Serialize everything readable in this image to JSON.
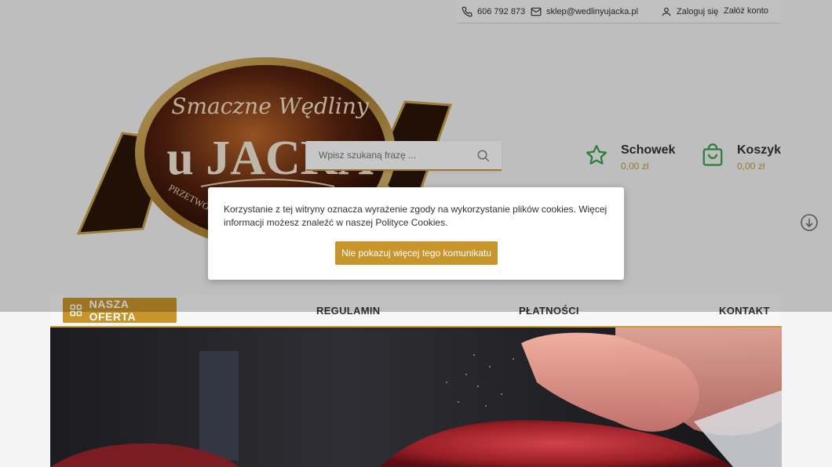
{
  "topbar": {
    "phone": "606 792 873",
    "email": "sklep@wedlinyujacka.pl",
    "login": "Zaloguj się",
    "register": "Załóż konto"
  },
  "logo": {
    "line1": "Smaczne Wędliny",
    "line2": "u JACKA",
    "ribbon": "PRZETWÓRSTWO MIĘSA"
  },
  "search": {
    "placeholder": "Wpisz szukaną frazę ..."
  },
  "wishlist": {
    "title": "Schowek",
    "value": "0,00 zł"
  },
  "cart": {
    "title": "Koszyk",
    "value": "0,00 zł"
  },
  "nav": {
    "offer": "NASZA OFERTA",
    "links": [
      "REGULAMIN",
      "PŁATNOŚCI",
      "KONTAKT"
    ]
  },
  "cookie": {
    "text": "Korzystanie z tej witryny oznacza wyrażenie zgody na wykorzystanie plików cookies. Więcej informacji możesz znaleźć w naszej Polityce Cookies.",
    "button": "Nie pokazuj więcej tego komunikatu"
  },
  "colors": {
    "accent": "#c8952c",
    "green": "#3aa04a"
  },
  "icons": [
    "phone-icon",
    "mail-icon",
    "user-icon",
    "search-icon",
    "star-icon",
    "bag-icon",
    "grid-icon",
    "arrow-down-circle-icon"
  ]
}
